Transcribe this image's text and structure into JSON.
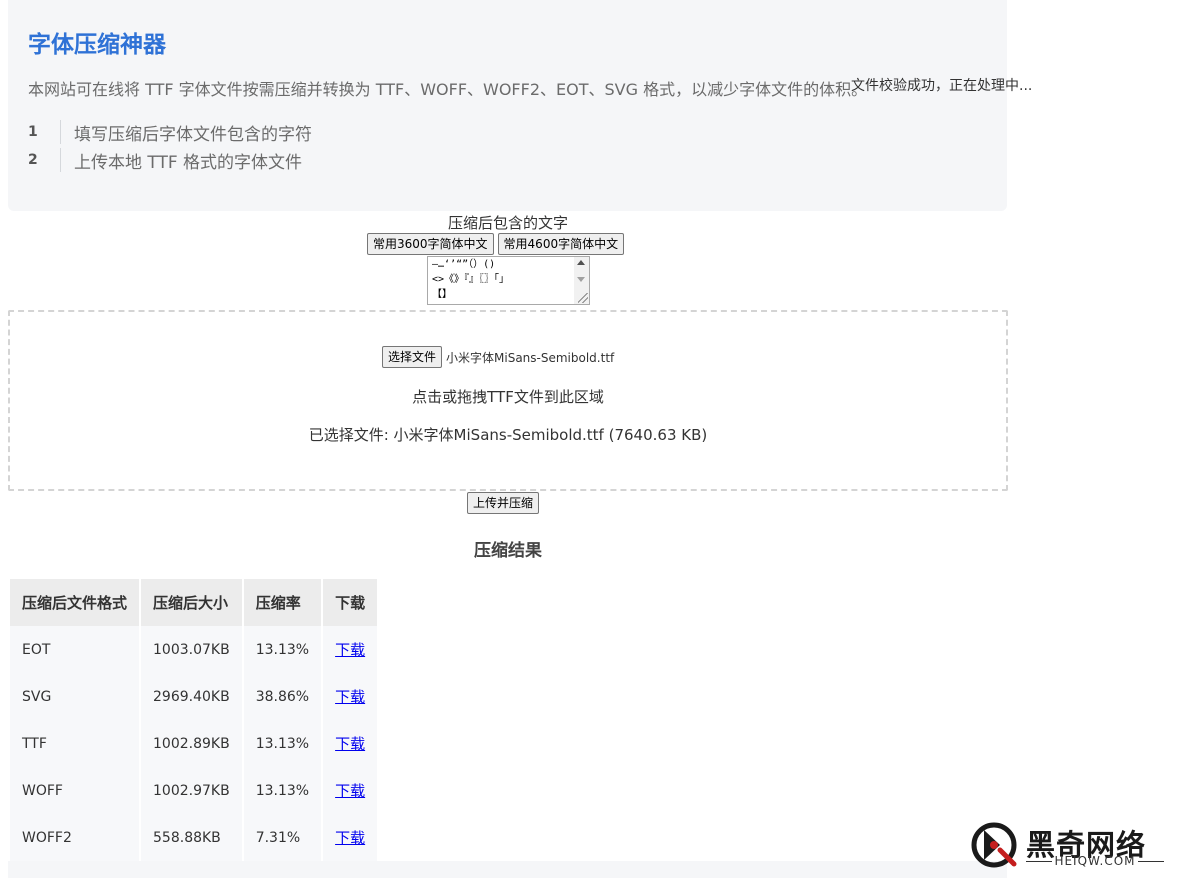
{
  "header": {
    "title": "字体压缩神器",
    "description": "本网站可在线将 TTF 字体文件按需压缩并转换为 TTF、WOFF、WOFF2、EOT、SVG 格式，以减少字体文件的体积。"
  },
  "status_message": "文件校验成功，正在处理中...",
  "steps": [
    {
      "num": "1",
      "text": "填写压缩后字体文件包含的字符"
    },
    {
      "num": "2",
      "text": "上传本地 TTF 格式的字体文件"
    }
  ],
  "chars_section": {
    "label": "压缩后包含的文字",
    "preset_3600": "常用3600字简体中文",
    "preset_4600": "常用4600字简体中文",
    "textarea_value": "—…‘’“”（）()\n<>《》『』〖〗「」\n【】"
  },
  "dropzone": {
    "choose_button": "选择文件",
    "file_name": "小米字体MiSans-Semibold.ttf",
    "hint": "点击或拖拽TTF文件到此区域",
    "selected_text": "已选择文件: 小米字体MiSans-Semibold.ttf (7640.63 KB)"
  },
  "upload_button": "上传并压缩",
  "results": {
    "title": "压缩结果",
    "headers": [
      "压缩后文件格式",
      "压缩后大小",
      "压缩率",
      "下载"
    ],
    "rows": [
      {
        "format": "EOT",
        "size": "1003.07KB",
        "ratio": "13.13%",
        "link": "下载"
      },
      {
        "format": "SVG",
        "size": "2969.40KB",
        "ratio": "38.86%",
        "link": "下载"
      },
      {
        "format": "TTF",
        "size": "1002.89KB",
        "ratio": "13.13%",
        "link": "下载"
      },
      {
        "format": "WOFF",
        "size": "1002.97KB",
        "ratio": "13.13%",
        "link": "下载"
      },
      {
        "format": "WOFF2",
        "size": "558.88KB",
        "ratio": "7.31%",
        "link": "下载"
      }
    ]
  },
  "watermark": {
    "name": "黑奇网络",
    "domain": "HEIQW.COM",
    "icon": "heiqw-logo-icon"
  },
  "colors": {
    "title_blue": "#2f72d6",
    "link_blue": "#0000ee",
    "intro_bg": "#f5f6f8"
  }
}
